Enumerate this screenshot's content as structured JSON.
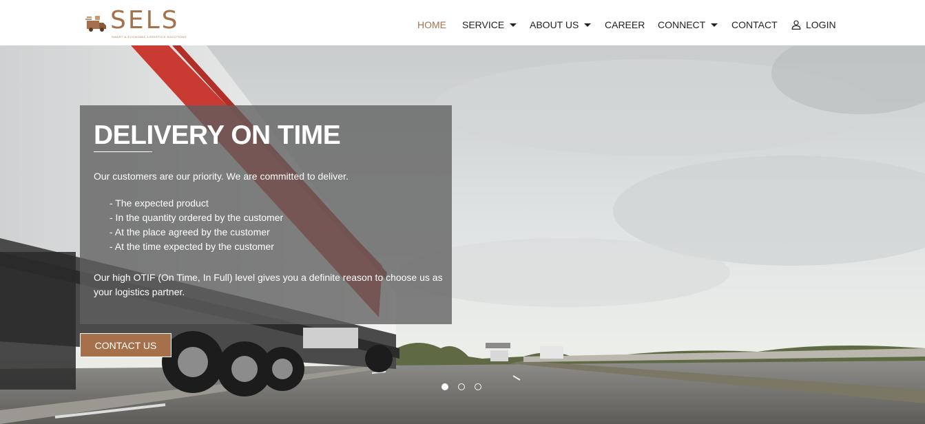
{
  "brand": {
    "name": "SELS",
    "tagline": "SMART & ECONOMIC LOGISTICS SOLUTIONS",
    "color": "#a6714a"
  },
  "nav": {
    "items": [
      {
        "label": "HOME",
        "active": true
      },
      {
        "label": "SERVICE",
        "dropdown": true
      },
      {
        "label": "ABOUT US",
        "dropdown": true
      },
      {
        "label": "CAREER"
      },
      {
        "label": "CONNECT",
        "dropdown": true
      },
      {
        "label": "CONTACT"
      },
      {
        "label": "LOGIN",
        "icon": "user-icon"
      }
    ]
  },
  "hero": {
    "title": "DELIVERY ON TIME",
    "intro": "Our customers are our priority. We are committed to deliver.",
    "points": [
      "- The expected product",
      "- In the quantity ordered by the customer",
      "- At the place agreed by the customer",
      "- At the time expected by the customer"
    ],
    "outro": "Our high OTIF (On Time, In Full) level gives you a definite reason to choose us as your logistics partner.",
    "cta_label": "CONTACT US",
    "slide_count": 3,
    "active_slide": 1
  }
}
